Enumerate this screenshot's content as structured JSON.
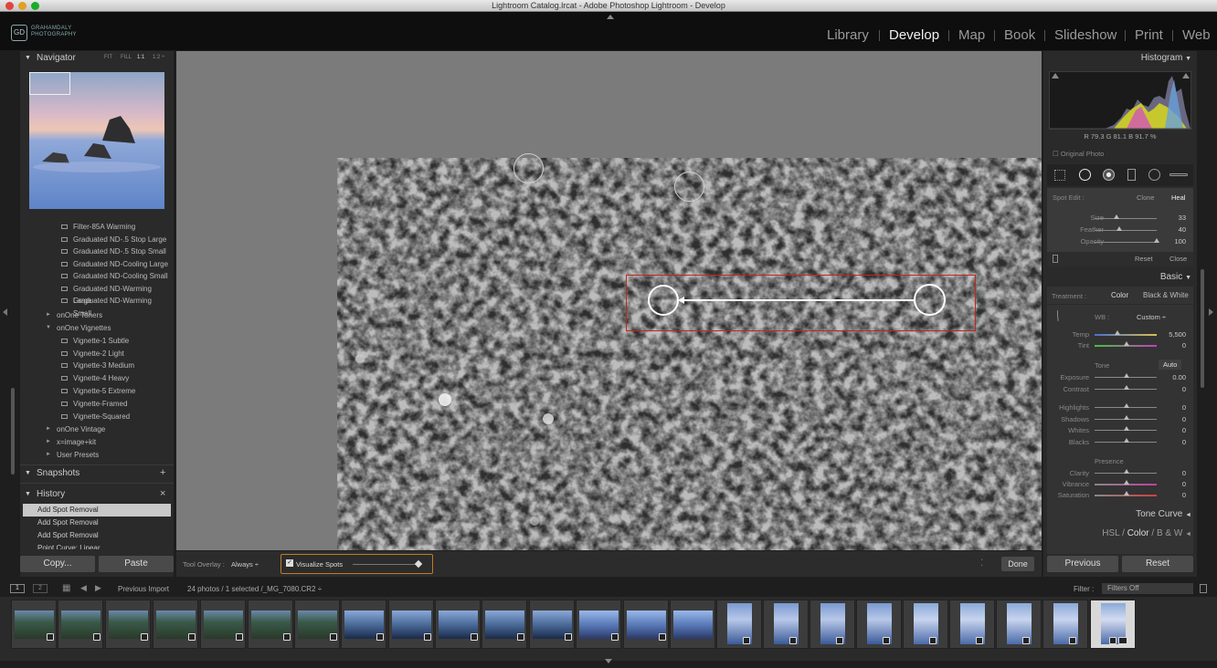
{
  "window": {
    "title": "Lightroom Catalog.lrcat - Adobe Photoshop Lightroom - Develop"
  },
  "identity": {
    "logo_mark": "GD",
    "logo_line1": "GRAHAMDALY",
    "logo_line2": "PHOTOGRAPHY"
  },
  "modules": [
    {
      "label": "Library",
      "active": false
    },
    {
      "label": "Develop",
      "active": true
    },
    {
      "label": "Map",
      "active": false
    },
    {
      "label": "Book",
      "active": false
    },
    {
      "label": "Slideshow",
      "active": false
    },
    {
      "label": "Print",
      "active": false
    },
    {
      "label": "Web",
      "active": false
    }
  ],
  "navigator": {
    "title": "Navigator",
    "zoom_options": [
      "FIT",
      "FILL",
      "1:1",
      "1:2 ÷"
    ]
  },
  "presets": {
    "items": [
      "Filter-85A Warming",
      "Graduated ND-.5 Stop Large",
      "Graduated ND-.5 Stop Small",
      "Graduated ND-Cooling Large",
      "Graduated ND-Cooling Small",
      "Graduated ND-Warming Large",
      "Graduated ND-Warming Small"
    ],
    "folder_toners": "onOne Toners",
    "folder_vignettes": "onOne Vignettes",
    "vignettes": [
      "Vignette-1 Subtle",
      "Vignette-2 Light",
      "Vignette-3 Medium",
      "Vignette-4 Heavy",
      "Vignette-5 Extreme",
      "Vignette-Framed",
      "Vignette-Squared"
    ],
    "folder_vintage": "onOne Vintage",
    "folder_imagekit": "x=image+kit",
    "folder_user": "User Presets"
  },
  "snapshots": {
    "title": "Snapshots",
    "add": "+"
  },
  "history": {
    "title": "History",
    "close": "×",
    "items": [
      "Add Spot Removal",
      "Add Spot Removal",
      "Add Spot Removal",
      "Point Curve: Linear"
    ]
  },
  "left_buttons": {
    "copy": "Copy...",
    "paste": "Paste"
  },
  "toolbar": {
    "overlay_label": "Tool Overlay :",
    "overlay_value": "Always ÷",
    "visualize_label": "Visualize Spots",
    "done": "Done"
  },
  "histogram": {
    "title": "Histogram",
    "readout": "R  79.3  G  81.1  B  91.7 %",
    "original_photo": "Original Photo"
  },
  "spot_edit": {
    "label": "Spot Edit :",
    "clone": "Clone",
    "heal": "Heal",
    "size_label": "Size",
    "size": "33",
    "size_level": 0.35,
    "feather_label": "Feather",
    "feather": "40",
    "feather_level": 0.4,
    "opacity_label": "Opacity",
    "opacity": "100",
    "opacity_level": 1.0,
    "reset": "Reset",
    "close": "Close"
  },
  "basic": {
    "title": "Basic",
    "treatment_label": "Treatment :",
    "color": "Color",
    "bw": "Black & White",
    "wb_label": "WB :",
    "wb_value": "Custom ÷",
    "temp_label": "Temp",
    "temp": "5,500",
    "tint_label": "Tint",
    "tint": "0",
    "tone_label": "Tone",
    "auto": "Auto",
    "sliders": [
      {
        "label": "Exposure",
        "value": "0.00"
      },
      {
        "label": "Contrast",
        "value": "0"
      },
      {
        "label": "Highlights",
        "value": "0"
      },
      {
        "label": "Shadows",
        "value": "0"
      },
      {
        "label": "Whites",
        "value": "0"
      },
      {
        "label": "Blacks",
        "value": "0"
      }
    ],
    "presence_label": "Presence",
    "presence": [
      {
        "label": "Clarity",
        "value": "0"
      },
      {
        "label": "Vibrance",
        "value": "0"
      },
      {
        "label": "Saturation",
        "value": "0"
      }
    ]
  },
  "tone_curve": {
    "title": "Tone Curve"
  },
  "hsl": {
    "hsl": "HSL",
    "color": "Color",
    "bw": "B & W"
  },
  "right_buttons": {
    "previous": "Previous",
    "reset": "Reset"
  },
  "filmstrip_bar": {
    "screen1": "1",
    "screen2": "2",
    "source": "Previous Import",
    "count": "24 photos / 1 selected /_MG_7080.CR2 ÷",
    "filter_label": "Filter :",
    "filter_value": "Filters Off"
  },
  "colors": {
    "accent_orange": "#c07a2a",
    "selection_red": "#c0281c"
  }
}
